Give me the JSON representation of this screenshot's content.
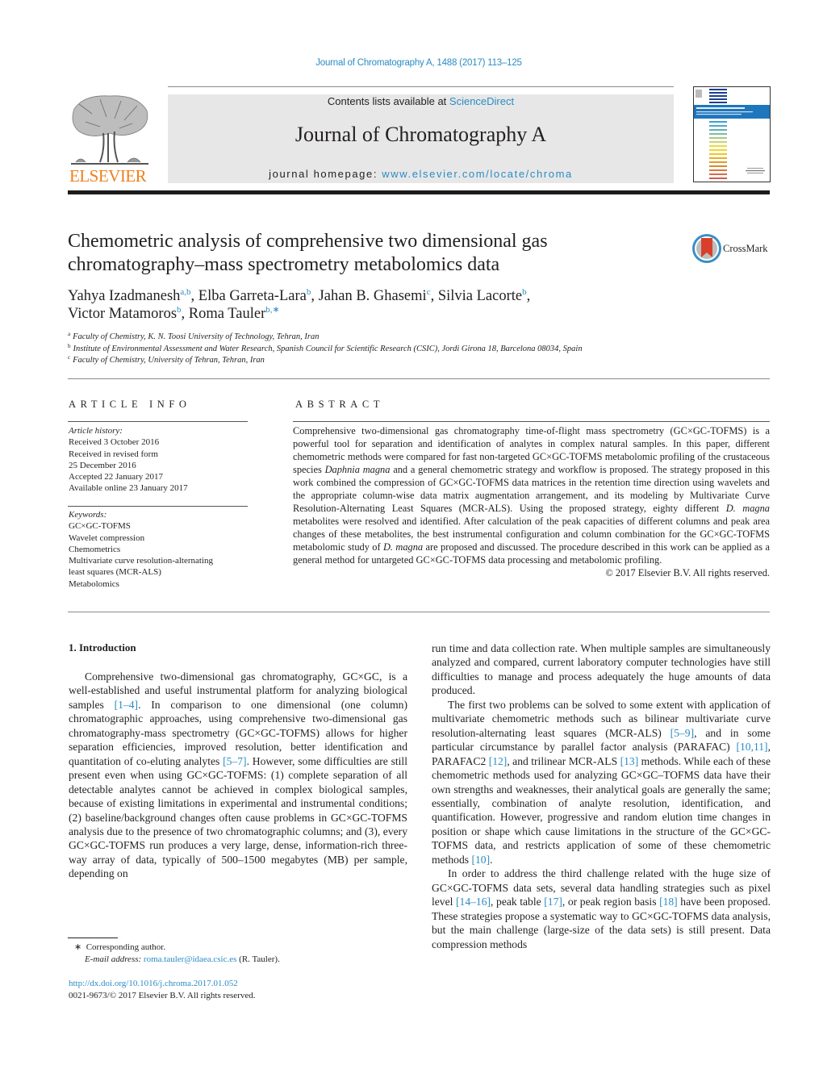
{
  "running_header": "Journal of Chromatography A, 1488 (2017) 113–125",
  "masthead": {
    "publisher": "ELSEVIER",
    "contents_prefix": "Contents lists available at ",
    "contents_link": "ScienceDirect",
    "journal_title": "Journal of Chromatography A",
    "homepage_prefix": "journal homepage: ",
    "homepage_link": "www.elsevier.com/locate/chroma"
  },
  "crossmark_label": "CrossMark",
  "article": {
    "title_line1": "Chemometric analysis of comprehensive two dimensional gas",
    "title_line2": "chromatography–mass spectrometry metabolomics data",
    "authors": [
      {
        "name": "Yahya Izadmanesh",
        "sup": "a,b",
        "sep": ", "
      },
      {
        "name": "Elba Garreta-Lara",
        "sup": "b",
        "sep": ", "
      },
      {
        "name": "Jahan B. Ghasemi",
        "sup": "c",
        "sep": ", "
      },
      {
        "name": "Silvia Lacorte",
        "sup": "b",
        "sep": ","
      },
      {
        "name": "Victor Matamoros",
        "sup": "b",
        "sep": ", "
      },
      {
        "name": "Roma Tauler",
        "sup": "b,∗",
        "sep": ""
      }
    ],
    "affiliations": [
      {
        "key": "a",
        "text": "Faculty of Chemistry, K. N. Toosi University of Technology, Tehran, Iran"
      },
      {
        "key": "b",
        "text": "Institute of Environmental Assessment and Water Research, Spanish Council for Scientific Research (CSIC), Jordi Girona 18, Barcelona 08034, Spain"
      },
      {
        "key": "c",
        "text": "Faculty of Chemistry, University of Tehran, Tehran, Iran"
      }
    ]
  },
  "article_info": {
    "heading": "ARTICLE INFO",
    "history_label": "Article history:",
    "history": [
      "Received 3 October 2016",
      "Received in revised form",
      "25 December 2016",
      "Accepted 22 January 2017",
      "Available online 23 January 2017"
    ],
    "keywords_label": "Keywords:",
    "keywords": [
      "GC×GC-TOFMS",
      "Wavelet compression",
      "Chemometrics",
      "Multivariate curve resolution-alternating",
      "least squares (MCR-ALS)",
      "Metabolomics"
    ]
  },
  "abstract": {
    "heading": "ABSTRACT",
    "p1": "Comprehensive two-dimensional gas chromatography time-of-flight mass spectrometry (GC×GC-TOFMS) is a powerful tool for separation and identification of analytes in complex natural samples. In this paper, different chemometric methods were compared for fast non-targeted GC×GC-TOFMS metabolomic profiling of the crustaceous species ",
    "i1": "Daphnia magna",
    "p2": " and a general chemometric strategy and workflow is proposed. The strategy proposed in this work combined the compression of GC×GC-TOFMS data matrices in the retention time direction using wavelets and the appropriate column-wise data matrix augmentation arrangement, and its modeling by Multivariate Curve Resolution-Alternating Least Squares (MCR-ALS). Using the proposed strategy, eighty different ",
    "i2": "D. magna",
    "p3": " metabolites were resolved and identified. After calculation of the peak capacities of different columns and peak area changes of these metabolites, the best instrumental configuration and column combination for the GC×GC-TOFMS metabolomic study of ",
    "i3": "D. magna",
    "p4": " are proposed and discussed. The procedure described in this work can be applied as a general method for untargeted GC×GC-TOFMS data processing and metabolomic profiling.",
    "copyright": "© 2017 Elsevier B.V. All rights reserved."
  },
  "body": {
    "section_title": "1.  Introduction",
    "left": {
      "t1": "Comprehensive two-dimensional gas chromatography, GC×GC, is a well-established and useful instrumental platform for analyzing biological samples ",
      "r1": "[1–4]",
      "t2": ". In comparison to one dimensional (one column) chromatographic approaches, using comprehensive two-dimensional gas chromatography-mass spectrometry (GC×GC-TOFMS) allows for higher separation efficiencies, improved resolution, better identification and quantitation of co-eluting analytes ",
      "r2": "[5–7]",
      "t3": ". However, some difficulties are still present even when using GC×GC-TOFMS: (1) complete separation of all detectable analytes cannot be achieved in complex biological samples, because of existing limitations in experimental and instrumental conditions; (2) baseline/background changes often cause problems in GC×GC-TOFMS analysis due to the presence of two chromatographic columns; and (3), every GC×GC-TOFMS run produces a very large, dense, information-rich three-way array of data, typically of 500–1500 megabytes (MB) per sample, depending on"
    },
    "right": {
      "p1": "run time and data collection rate. When multiple samples are simultaneously analyzed and compared, current laboratory computer technologies have still difficulties to manage and process adequately the huge amounts of data produced.",
      "p2a": "The first two problems can be solved to some extent with application of multivariate chemometric methods such as bilinear multivariate curve resolution-alternating least squares (MCR-ALS) ",
      "r1": "[5–9]",
      "p2b": ", and in some particular circumstance by parallel factor analysis (PARAFAC) ",
      "r2": "[10,11]",
      "p2c": ", PARAFAC2 ",
      "r3": "[12]",
      "p2d": ", and trilinear MCR-ALS ",
      "r4": "[13]",
      "p2e": " methods. While each of these chemometric methods used for analyzing GC×GC–TOFMS data have their own strengths and weaknesses, their analytical goals are generally the same; essentially, combination of analyte resolution, identification, and quantification. However, progressive and random elution time changes in position or shape which cause limitations in the structure of the GC×GC-TOFMS data, and restricts application of some of these chemometric methods ",
      "r5": "[10]",
      "p2f": ".",
      "p3a": "In order to address the third challenge related with the huge size of GC×GC-TOFMS data sets, several data handling strategies such as pixel level ",
      "r6": "[14–16]",
      "p3b": ", peak table ",
      "r7": "[17]",
      "p3c": ", or peak region basis ",
      "r8": "[18]",
      "p3d": " have been proposed. These strategies propose a systematic way to GC×GC-TOFMS data analysis, but the main challenge (large-size of the data sets) is still present. Data compression methods"
    }
  },
  "footnotes": {
    "star": "∗",
    "corresponding": "Corresponding author.",
    "email_label": "E-mail address: ",
    "email": "roma.tauler@idaea.csic.es",
    "email_suffix": " (R. Tauler).",
    "doi": "http://dx.doi.org/10.1016/j.chroma.2017.01.052",
    "issn": "0021-9673/© 2017 Elsevier B.V. All rights reserved."
  }
}
